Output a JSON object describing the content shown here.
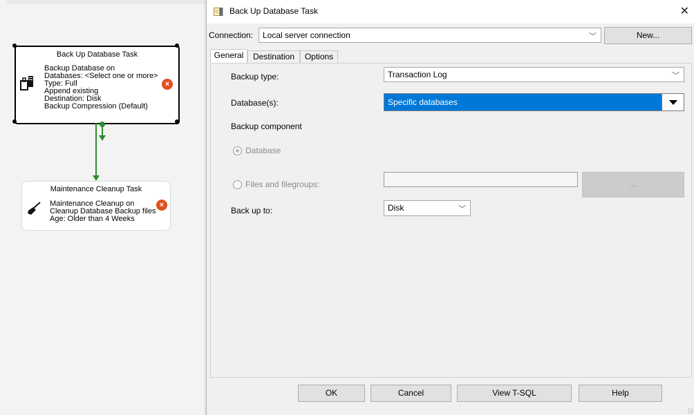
{
  "canvas": {
    "backup_task": {
      "title": "Back Up Database Task",
      "lines": [
        "Backup Database on",
        "Databases: <Select one or more>",
        "Type: Full",
        "Append existing",
        "Destination: Disk",
        "Backup Compression (Default)"
      ],
      "icon": "backup-task-icon",
      "error_icon": "error-x-icon"
    },
    "cleanup_task": {
      "title": "Maintenance Cleanup Task",
      "lines": [
        "Maintenance Cleanup on",
        "Cleanup Database Backup files",
        "Age: Older than 4 Weeks"
      ],
      "icon": "broom-icon",
      "error_icon": "error-x-icon"
    },
    "connector_color": "#2e8b2e"
  },
  "dialog": {
    "title": "Back Up Database Task",
    "close_glyph": "✕",
    "connection": {
      "label": "Connection:",
      "value": "Local server connection",
      "new_button": "New..."
    },
    "tabs": [
      "General",
      "Destination",
      "Options"
    ],
    "active_tab": "General",
    "general": {
      "backup_type_label": "Backup type:",
      "backup_type_value": "Transaction Log",
      "databases_label": "Database(s):",
      "databases_value": "Specific databases",
      "backup_component_label": "Backup component",
      "radio_database": "Database",
      "radio_files": "Files and filegroups:",
      "files_value": "",
      "browse_button": "...",
      "back_up_to_label": "Back up to:",
      "back_up_to_value": "Disk"
    },
    "footer": {
      "ok": "OK",
      "cancel": "Cancel",
      "view_tsql": "View T-SQL",
      "help": "Help"
    },
    "accent_color": "#0078d7"
  }
}
